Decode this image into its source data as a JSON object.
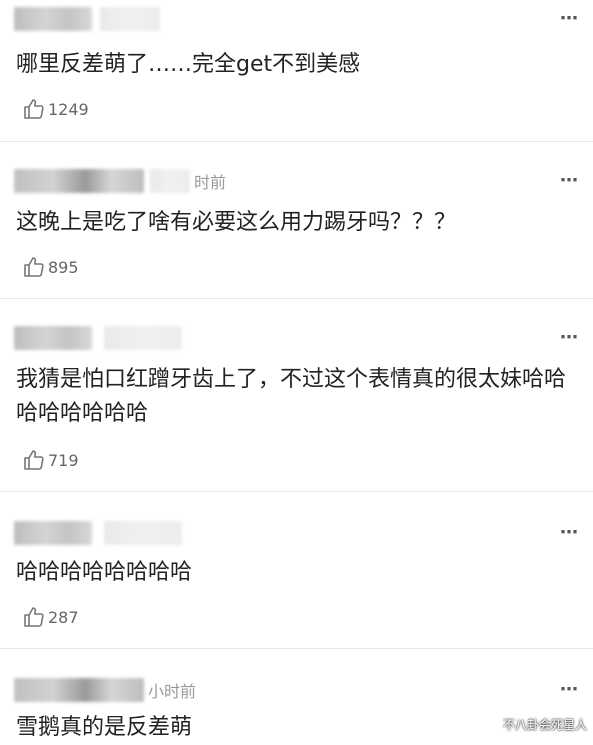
{
  "comments": [
    {
      "time": "",
      "text": "哪里反差萌了……完全get不到美感",
      "likes": "1249"
    },
    {
      "time": "时前",
      "text": "这晚上是吃了啥有必要这么用力踢牙吗？？？",
      "likes": "895"
    },
    {
      "time": "",
      "text": "我猜是怕口红蹭牙齿上了，不过这个表情真的很太妹哈哈哈哈哈哈哈哈",
      "likes": "719"
    },
    {
      "time": "",
      "text": "哈哈哈哈哈哈哈哈",
      "likes": "287"
    },
    {
      "time": "小时前",
      "text": "雪鹅真的是反差萌",
      "likes": ""
    }
  ],
  "more_icon": "⋯",
  "watermark": "不八卦会死星人"
}
